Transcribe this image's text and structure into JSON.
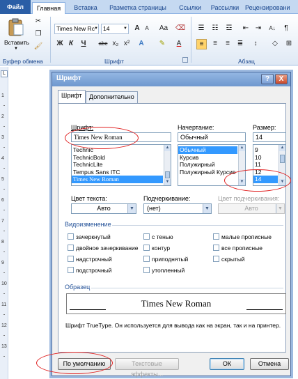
{
  "ribbon": {
    "tabs": [
      "Файл",
      "Главная",
      "Вставка",
      "Разметка страницы",
      "Ссылки",
      "Рассылки",
      "Рецензировани"
    ],
    "active_tab": "Главная",
    "clipboard": {
      "paste_label": "Вставить",
      "group_label": "Буфер обмена"
    },
    "font": {
      "name": "Times New Rc",
      "size": "14",
      "group_label": "Шрифт",
      "change_case": "Aa"
    },
    "paragraph": {
      "group_label": "Абзац"
    }
  },
  "ruler": {
    "numbers": [
      "1",
      "2",
      "3",
      "4",
      "5",
      "6",
      "7",
      "8",
      "9",
      "10",
      "11",
      "12",
      "13"
    ]
  },
  "dialog": {
    "title": "Шрифт",
    "help": "?",
    "close": "X",
    "tabs": [
      "Шрифт",
      "Дополнительно"
    ],
    "font_label": "Шрифт:",
    "font_value": "Times New Roman",
    "font_list": [
      "Technic",
      "TechnicBold",
      "TechnicLite",
      "Tempus Sans ITC",
      "Times New Roman"
    ],
    "style_label": "Начертание:",
    "style_value": "Обычный",
    "style_list": [
      "Обычный",
      "Курсив",
      "Полужирный",
      "Полужирный Курсив"
    ],
    "size_label": "Размер:",
    "size_value": "14",
    "size_list": [
      "9",
      "10",
      "11",
      "12",
      "14"
    ],
    "text_color_label": "Цвет текста:",
    "text_color_value": "Авто",
    "underline_label": "Подчеркивание:",
    "underline_value": "(нет)",
    "underline_color_label": "Цвет подчеркивания:",
    "underline_color_value": "Авто",
    "effects_label": "Видоизменение",
    "effects": {
      "col1": [
        "зачеркнутый",
        "двойное зачеркивание",
        "надстрочный",
        "подстрочный"
      ],
      "col2": [
        "с тенью",
        "контур",
        "приподнятый",
        "утопленный"
      ],
      "col3": [
        "малые прописные",
        "все прописные",
        "скрытый"
      ]
    },
    "preview_label": "Образец",
    "preview_text": "Times New Roman",
    "description": "Шрифт TrueType. Он используется для вывода как на экран, так и на принтер.",
    "buttons": {
      "default": "По умолчанию",
      "text_effects": "Текстовые эффекты...",
      "ok": "ОК",
      "cancel": "Отмена"
    }
  },
  "colors": {
    "ribbon_blue": "#c5d9f1",
    "file_tab": "#2a5ea6",
    "selection": "#3399ff",
    "annotation_red": "#e02020"
  }
}
